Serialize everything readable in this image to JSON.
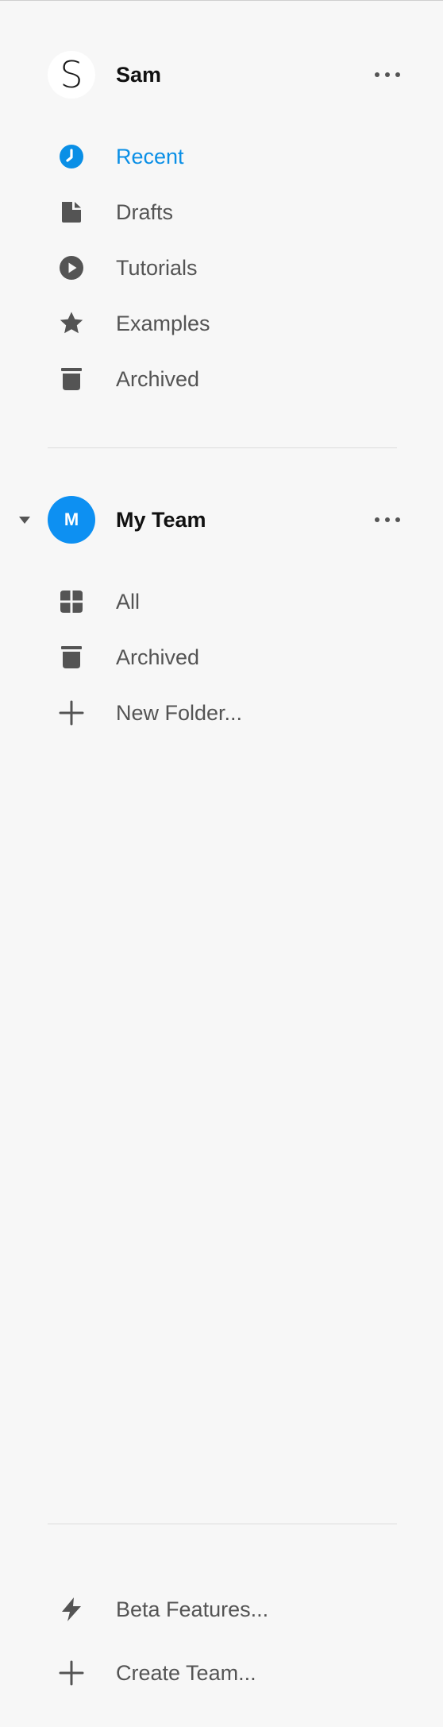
{
  "user": {
    "avatar_letter": "S",
    "name": "Sam"
  },
  "nav": {
    "items": [
      {
        "label": "Recent",
        "icon": "clock-icon",
        "active": true
      },
      {
        "label": "Drafts",
        "icon": "file-icon"
      },
      {
        "label": "Tutorials",
        "icon": "play-circle-icon"
      },
      {
        "label": "Examples",
        "icon": "star-icon"
      },
      {
        "label": "Archived",
        "icon": "trash-icon"
      }
    ]
  },
  "team": {
    "avatar_letter": "M",
    "name": "My Team",
    "items": [
      {
        "label": "All",
        "icon": "grid-icon"
      },
      {
        "label": "Archived",
        "icon": "trash-icon"
      },
      {
        "label": "New Folder...",
        "icon": "plus-icon"
      }
    ]
  },
  "footer": {
    "items": [
      {
        "label": "Beta Features...",
        "icon": "lightning-icon"
      },
      {
        "label": "Create Team...",
        "icon": "plus-icon"
      }
    ]
  },
  "colors": {
    "accent": "#0a8fe6",
    "team_avatar": "#0d90f2",
    "icon": "#545454",
    "background": "#f7f7f7"
  }
}
